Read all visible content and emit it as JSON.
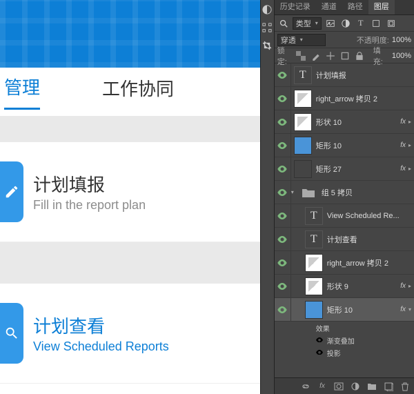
{
  "design": {
    "tabs": [
      "管理",
      "工作协同"
    ],
    "cards": [
      {
        "zh": "计划填报",
        "en": "Fill in the report plan"
      },
      {
        "zh": "计划查看",
        "en": "View Scheduled Reports"
      }
    ]
  },
  "panel": {
    "tabs": [
      "历史记录",
      "通道",
      "路径",
      "图层"
    ],
    "kind_label": "类型",
    "blend_mode": "穿透",
    "opacity_label": "不透明度:",
    "opacity_value": "100%",
    "lock_label": "锁定:",
    "fill_label": "填充:",
    "fill_value": "100%",
    "fx_label": "fx",
    "effects_title": "效果",
    "effect_items": [
      "渐变叠加",
      "投影"
    ],
    "layers": [
      {
        "type": "text",
        "name": "计划填报",
        "fx": false
      },
      {
        "type": "shape",
        "name": "right_arrow 拷贝 2",
        "fx": false
      },
      {
        "type": "shape",
        "name": "形状 10",
        "fx": true
      },
      {
        "type": "blue",
        "name": "矩形 10",
        "fx": true
      },
      {
        "type": "shape-dark",
        "name": "矩形 27",
        "fx": true
      },
      {
        "type": "folder",
        "name": "组 5 拷贝",
        "fx": false
      },
      {
        "type": "text",
        "name": "View Scheduled Re...",
        "fx": false,
        "indent": 1
      },
      {
        "type": "text",
        "name": "计划查看",
        "fx": false,
        "indent": 1
      },
      {
        "type": "shape",
        "name": "right_arrow 拷贝 2",
        "fx": false,
        "indent": 1
      },
      {
        "type": "shape",
        "name": "形状 9",
        "fx": true,
        "indent": 1
      },
      {
        "type": "blue",
        "name": "矩形 10",
        "fx": true,
        "indent": 1,
        "selected": true,
        "expanded": true
      }
    ]
  }
}
